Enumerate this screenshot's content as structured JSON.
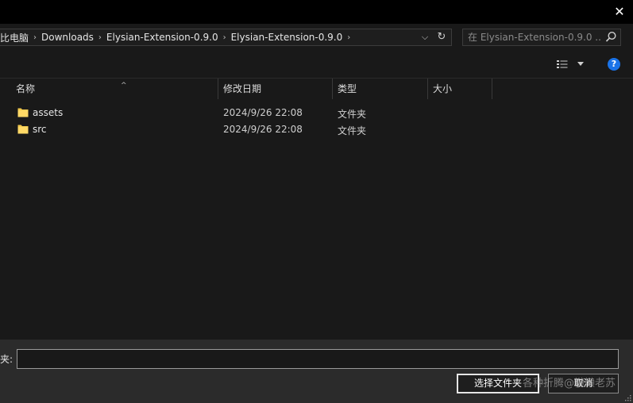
{
  "titlebar": {
    "close_glyph": "✕"
  },
  "address": {
    "crumbs": [
      "比电脑",
      "Downloads",
      "Elysian-Extension-0.9.0",
      "Elysian-Extension-0.9.0"
    ],
    "separator": "›",
    "dropdown_glyph": "⌵",
    "refresh_glyph": "↻"
  },
  "search": {
    "placeholder": "在 Elysian-Extension-0.9.0 ..."
  },
  "toolbar": {
    "help_glyph": "?"
  },
  "columns": {
    "name": "名称",
    "date": "修改日期",
    "type": "类型",
    "size": "大小",
    "sort_glyph": "^"
  },
  "files": [
    {
      "name": "assets",
      "date": "2024/9/26 22:08",
      "type": "文件夹"
    },
    {
      "name": "src",
      "date": "2024/9/26 22:08",
      "type": "文件夹"
    }
  ],
  "footer": {
    "folder_label": "夹:",
    "folder_value": "",
    "select_button": "选择文件夹",
    "cancel_button": "取消",
    "watermark": "各种折腾@懒懒老苏"
  },
  "colors": {
    "accent": "#1a73e8",
    "folder": "#f2c94c",
    "background": "#191919"
  },
  "icons": {
    "folder": "folder-icon",
    "search": "search-icon",
    "view": "view-options-icon",
    "help": "help-icon",
    "close": "close-icon"
  }
}
